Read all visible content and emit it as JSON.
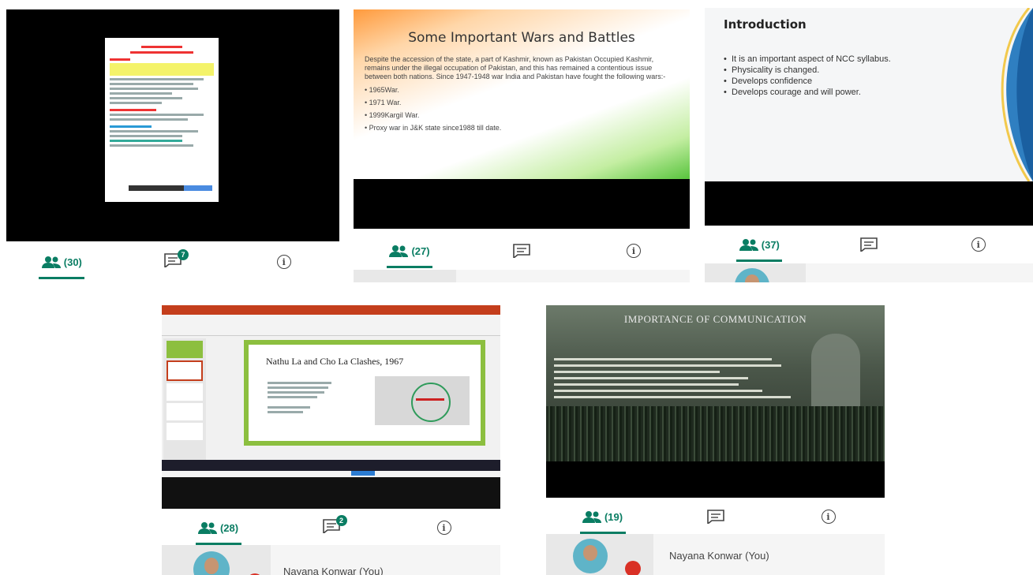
{
  "panel1": {
    "participants_count": "(30)",
    "chat_badge": "7"
  },
  "panel2": {
    "slide_title": "Some Important Wars and Battles",
    "slide_paragraph": "Despite the accession of the state, a part of Kashmir, known as Pakistan Occupied Kashmir, remains under the illegal occupation of Pakistan, and this has remained a contentious issue between both nations. Since 1947-1948 war India and Pakistan have fought the following wars:-",
    "bullets": [
      "1965War.",
      "1971 War.",
      "1999Kargil War.",
      "Proxy war in J&K state since1988 till date."
    ],
    "participants_count": "(27)"
  },
  "panel3": {
    "slide_title": "Introduction",
    "bullets": [
      "It is an important aspect of NCC syllabus.",
      "Physicality is changed.",
      "Develops confidence",
      "Develops courage and will power."
    ],
    "participants_count": "(37)"
  },
  "panel4": {
    "slide_title": "Nathu La and Cho La Clashes, 1967",
    "participants_count": "(28)",
    "chat_badge": "2",
    "participant_name": "Nayana Konwar (You)"
  },
  "panel5": {
    "slide_title": "IMPORTANCE OF COMMUNICATION",
    "participants_count": "(19)",
    "participant_name": "Nayana Konwar (You)"
  },
  "colors": {
    "accent": "#0a7d63",
    "mute": "#d93025"
  }
}
